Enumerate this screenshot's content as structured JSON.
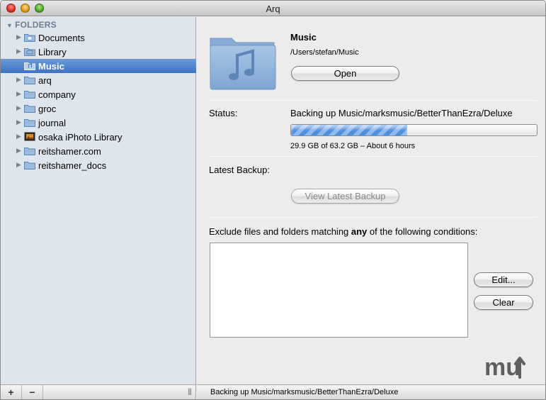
{
  "window": {
    "title": "Arq"
  },
  "sidebar": {
    "header": "FOLDERS",
    "items": [
      {
        "label": "Documents",
        "icon": "documents-folder-icon",
        "selected": false
      },
      {
        "label": "Library",
        "icon": "library-folder-icon",
        "selected": false
      },
      {
        "label": "Music",
        "icon": "music-folder-icon",
        "selected": true
      },
      {
        "label": "arq",
        "icon": "folder-icon",
        "selected": false
      },
      {
        "label": "company",
        "icon": "folder-icon",
        "selected": false
      },
      {
        "label": "groc",
        "icon": "folder-icon",
        "selected": false
      },
      {
        "label": "journal",
        "icon": "folder-icon",
        "selected": false
      },
      {
        "label": "osaka iPhoto Library",
        "icon": "iphoto-library-icon",
        "selected": false
      },
      {
        "label": "reitshamer.com",
        "icon": "folder-icon",
        "selected": false
      },
      {
        "label": "reitshamer_docs",
        "icon": "folder-icon",
        "selected": false
      }
    ],
    "footer": {
      "add_label": "+",
      "remove_label": "−",
      "grip": "|||"
    }
  },
  "detail": {
    "folder_name": "Music",
    "folder_path": "/Users/stefan/Music",
    "open_label": "Open",
    "status_label": "Status:",
    "status_text": "Backing up Music/marksmusic/BetterThanEzra/Deluxe",
    "progress_fraction": 0.473,
    "progress_detail": "29.9 GB of 63.2 GB – About 6 hours",
    "latest_backup_label": "Latest Backup:",
    "view_latest_label": "View Latest Backup",
    "exclude_prefix": "Exclude files and folders matching ",
    "exclude_emphasis": "any",
    "exclude_suffix": " of the following conditions:",
    "edit_label": "Edit...",
    "clear_label": "Clear",
    "logo_text": "mu"
  },
  "status_bar": {
    "text": "Backing up Music/marksmusic/BetterThanEzra/Deluxe"
  },
  "colors": {
    "selection": "#3e72c3",
    "sidebar_bg": "#dfe5ec",
    "progress": "#4f8ee0",
    "folder": "#8fb3d8"
  }
}
